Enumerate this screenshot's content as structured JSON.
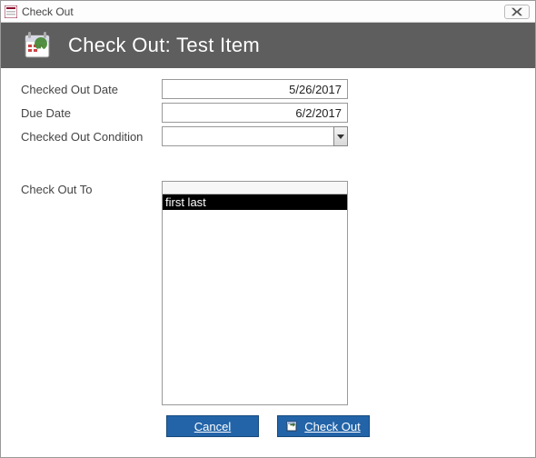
{
  "window": {
    "title": "Check Out"
  },
  "header": {
    "title": "Check Out: Test Item"
  },
  "fields": {
    "checked_out_date": {
      "label": "Checked Out Date",
      "value": "5/26/2017"
    },
    "due_date": {
      "label": "Due Date",
      "value": "6/2/2017"
    },
    "condition": {
      "label": "Checked Out Condition",
      "value": ""
    },
    "check_out_to": {
      "label": "Check Out To"
    }
  },
  "contacts": {
    "items": [
      {
        "display": "first last",
        "selected": true
      }
    ]
  },
  "buttons": {
    "cancel": {
      "label": "Cancel"
    },
    "checkout": {
      "label": "Check Out"
    }
  },
  "colors": {
    "header_gray": "#5e5e5e",
    "button_blue": "#2364a8"
  }
}
